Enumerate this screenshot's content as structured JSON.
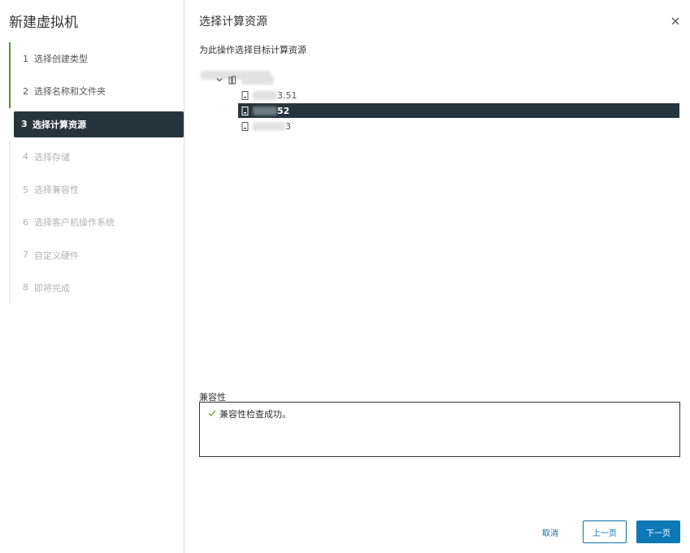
{
  "wizard": {
    "title": "新建虚拟机",
    "steps": [
      {
        "num": "1",
        "label": "选择创建类型",
        "state": "done"
      },
      {
        "num": "2",
        "label": "选择名称和文件夹",
        "state": "done"
      },
      {
        "num": "3",
        "label": "选择计算资源",
        "state": "active"
      },
      {
        "num": "4",
        "label": "选择存储",
        "state": "pending"
      },
      {
        "num": "5",
        "label": "选择兼容性",
        "state": "pending"
      },
      {
        "num": "6",
        "label": "选择客户机操作系统",
        "state": "pending"
      },
      {
        "num": "7",
        "label": "自定义硬件",
        "state": "pending"
      },
      {
        "num": "8",
        "label": "即将完成",
        "state": "pending"
      }
    ]
  },
  "page": {
    "title": "选择计算资源",
    "instruction": "为此操作选择目标计算资源"
  },
  "tree": {
    "hosts": [
      {
        "suffix": "3.51",
        "selected": false
      },
      {
        "suffix": "52",
        "selected": true
      },
      {
        "suffix": "3",
        "selected": false
      }
    ]
  },
  "compatibility": {
    "label": "兼容性",
    "message": "兼容性检查成功。"
  },
  "buttons": {
    "cancel": "取消",
    "back": "上一页",
    "next": "下一页"
  },
  "colors": {
    "selected_bg": "#26353d",
    "done_bar": "#5f8f32",
    "accent": "#0e78b7",
    "success": "#5f8f32"
  }
}
